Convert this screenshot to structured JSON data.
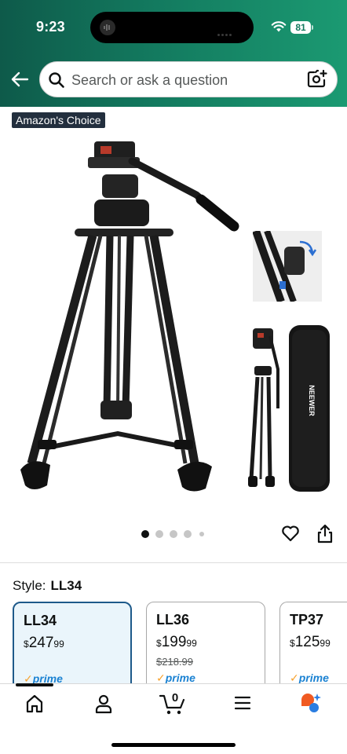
{
  "status_bar": {
    "time": "9:23",
    "battery": "81"
  },
  "search": {
    "placeholder": "Search or ask a question"
  },
  "product": {
    "badge": "Amazon's Choice",
    "gallery_dot_count": 5,
    "gallery_active_index": 0
  },
  "style": {
    "label": "Style:",
    "selected": "LL34",
    "options": [
      {
        "name": "LL34",
        "currency": "$",
        "whole": "247",
        "cents": "99",
        "old_price": "",
        "prime": "prime"
      },
      {
        "name": "LL36",
        "currency": "$",
        "whole": "199",
        "cents": "99",
        "old_price": "$218.99",
        "prime": "prime"
      },
      {
        "name": "TP37",
        "currency": "$",
        "whole": "125",
        "cents": "99",
        "old_price": "",
        "prime": "prime"
      }
    ]
  },
  "nav": {
    "cart_count": "0"
  },
  "colors": {
    "header_start": "#0e5a4a",
    "header_end": "#1b9a72",
    "prime_blue": "#1b82d2",
    "selected_border": "#1e5a8a"
  }
}
